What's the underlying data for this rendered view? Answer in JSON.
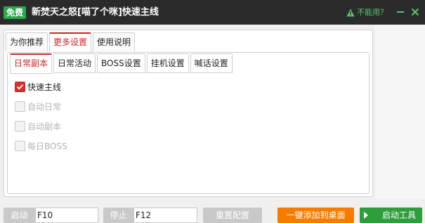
{
  "titlebar": {
    "badge": "免费",
    "title": "新焚天之怒[喵了个咪]快速主线",
    "warn_text": "不能用？",
    "colors": {
      "bar": "#2b2b2b",
      "badge": "#2aa84a",
      "accent": "#5cc26f"
    }
  },
  "tabs_top": [
    "为你推荐",
    "更多设置",
    "使用说明"
  ],
  "tabs_top_active": "更多设置",
  "tabs_sub": [
    "日常副本",
    "日常活动",
    "BOSS设置",
    "挂机设置",
    "喊话设置"
  ],
  "tabs_sub_active": "日常副本",
  "options": [
    {
      "label": "快速主线",
      "checked": true,
      "enabled": true
    },
    {
      "label": "自动日常",
      "checked": false,
      "enabled": false
    },
    {
      "label": "自动副本",
      "checked": false,
      "enabled": false
    },
    {
      "label": "每日BOSS",
      "checked": false,
      "enabled": false
    }
  ],
  "bottom": {
    "start_label": "启动",
    "start_hotkey": "F10",
    "stop_label": "停止",
    "stop_hotkey": "F12",
    "reset_label": "重置配置",
    "add_desktop_label": "一键添加到桌面",
    "launch_label": "启动工具"
  }
}
